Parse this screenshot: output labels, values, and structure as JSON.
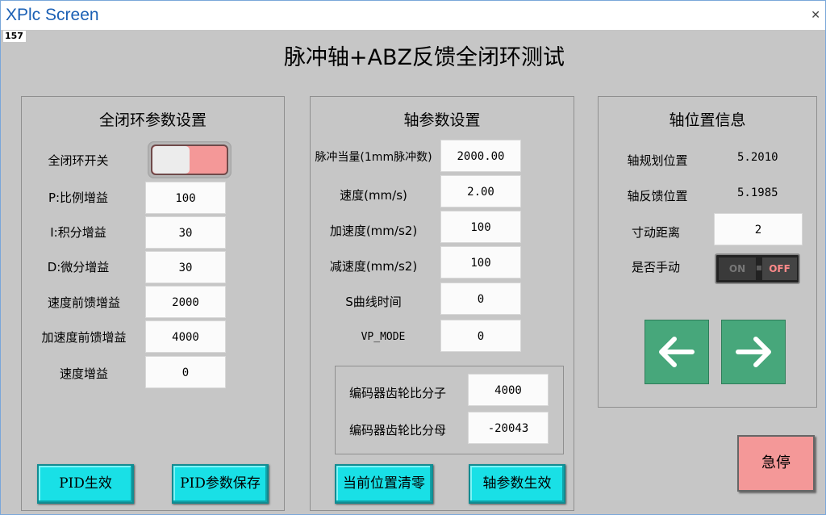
{
  "window": {
    "title": "XPlc Screen",
    "counter": "157"
  },
  "page_title": "脉冲轴+ABZ反馈全闭环测试",
  "closed_loop": {
    "title": "全闭环参数设置",
    "switch_label": "全闭环开关",
    "params": [
      {
        "label": "P:比例增益",
        "value": "100"
      },
      {
        "label": "I:积分增益",
        "value": "30"
      },
      {
        "label": "D:微分增益",
        "value": "30"
      },
      {
        "label": "速度前馈增益",
        "value": "2000"
      },
      {
        "label": "加速度前馈增益",
        "value": "4000"
      },
      {
        "label": "速度增益",
        "value": "0"
      }
    ],
    "btn_apply": "PID生效",
    "btn_save": "PID参数保存"
  },
  "axis_params": {
    "title": "轴参数设置",
    "params": [
      {
        "label": "脉冲当量(1mm脉冲数)",
        "value": "2000.00"
      },
      {
        "label": "速度(mm/s)",
        "value": "2.00"
      },
      {
        "label": "加速度(mm/s2)",
        "value": "100"
      },
      {
        "label": "减速度(mm/s2)",
        "value": "100"
      },
      {
        "label": "S曲线时间",
        "value": "0"
      },
      {
        "label": "VP_MODE",
        "value": "0"
      }
    ],
    "encoder": [
      {
        "label": "编码器齿轮比分子",
        "value": "4000"
      },
      {
        "label": "编码器齿轮比分母",
        "value": "-20043"
      }
    ],
    "btn_clear": "当前位置清零",
    "btn_apply": "轴参数生效"
  },
  "axis_pos": {
    "title": "轴位置信息",
    "planned_label": "轴规划位置",
    "planned_value": "5.2010",
    "feedback_label": "轴反馈位置",
    "feedback_value": "5.1985",
    "jog_label": "寸动距离",
    "jog_value": "2",
    "manual_label": "是否手动",
    "toggle_on": "ON",
    "toggle_off": "OFF"
  },
  "estop": "急停",
  "colors": {
    "cyan_button": "#19e0e6",
    "arrow_button": "#47a77b",
    "estop": "#f49898",
    "switch_on": "#f49898"
  }
}
